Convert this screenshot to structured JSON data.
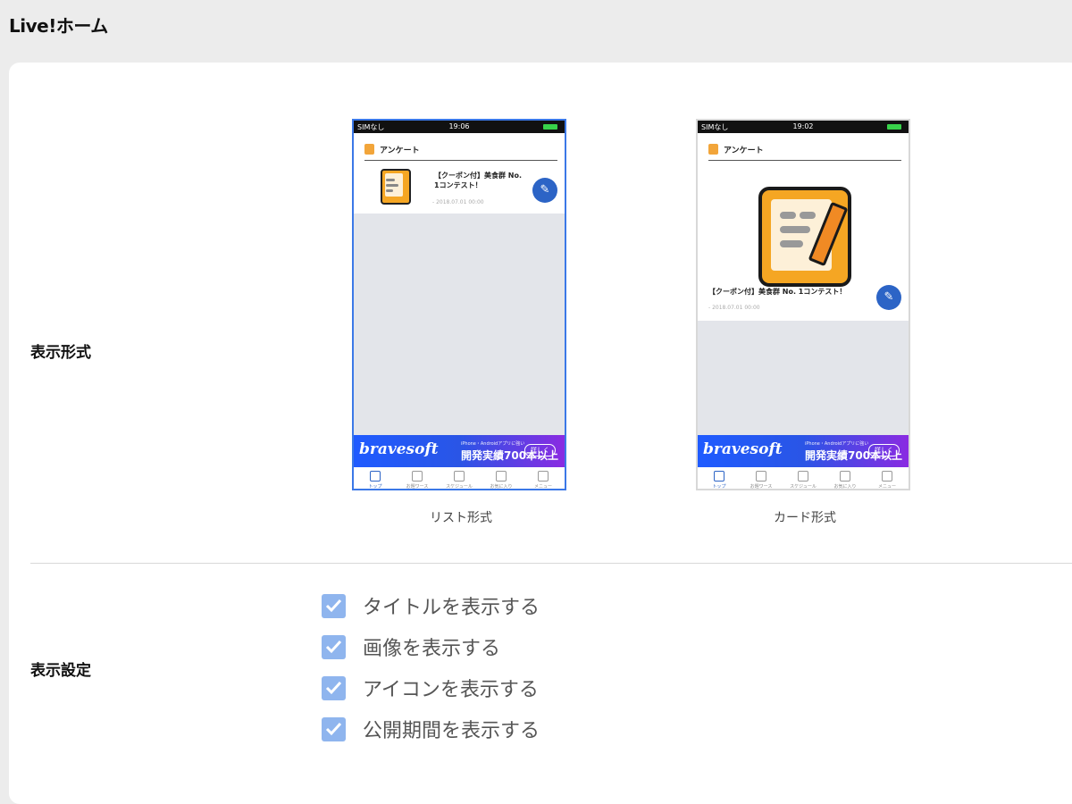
{
  "header": {
    "title": "Live!ホーム"
  },
  "display_format": {
    "label": "表示形式",
    "options": [
      {
        "caption": "リスト形式",
        "selected": true,
        "phone": {
          "carrier": "SIMなし",
          "time": "19:06",
          "section": "アンケート",
          "item_title": "【クーポン付】美食群 No. 1コンテスト！",
          "item_date": "- 2018.07.01 00:00",
          "banner": {
            "logo": "bravesoft",
            "sub": "iPhone・Androidアプリに強い",
            "big": "開発実績700本以上",
            "button": "詳しく"
          },
          "tabs": [
            "トップ",
            "お題ワース",
            "スケジュール",
            "お気に入り",
            "メニュー"
          ]
        }
      },
      {
        "caption": "カード形式",
        "selected": false,
        "phone": {
          "carrier": "SIMなし",
          "time": "19:02",
          "section": "アンケート",
          "item_title": "【クーポン付】美食群 No. 1コンテスト！",
          "item_date": "- 2018.07.01 00:00",
          "banner": {
            "logo": "bravesoft",
            "sub": "iPhone・Androidアプリに強い",
            "big": "開発実績700本以上",
            "button": "詳しく"
          },
          "tabs": [
            "トップ",
            "お題ワース",
            "スケジュール",
            "お気に入り",
            "メニュー"
          ]
        }
      }
    ]
  },
  "display_settings": {
    "label": "表示設定",
    "items": [
      {
        "label": "タイトルを表示する",
        "checked": true
      },
      {
        "label": "画像を表示する",
        "checked": true
      },
      {
        "label": "アイコンを表示する",
        "checked": true
      },
      {
        "label": "公開期間を表示する",
        "checked": true
      }
    ]
  },
  "colors": {
    "accent": "#3b78e7",
    "checkbox": "#8fb5ee",
    "fab": "#2c64c6"
  }
}
